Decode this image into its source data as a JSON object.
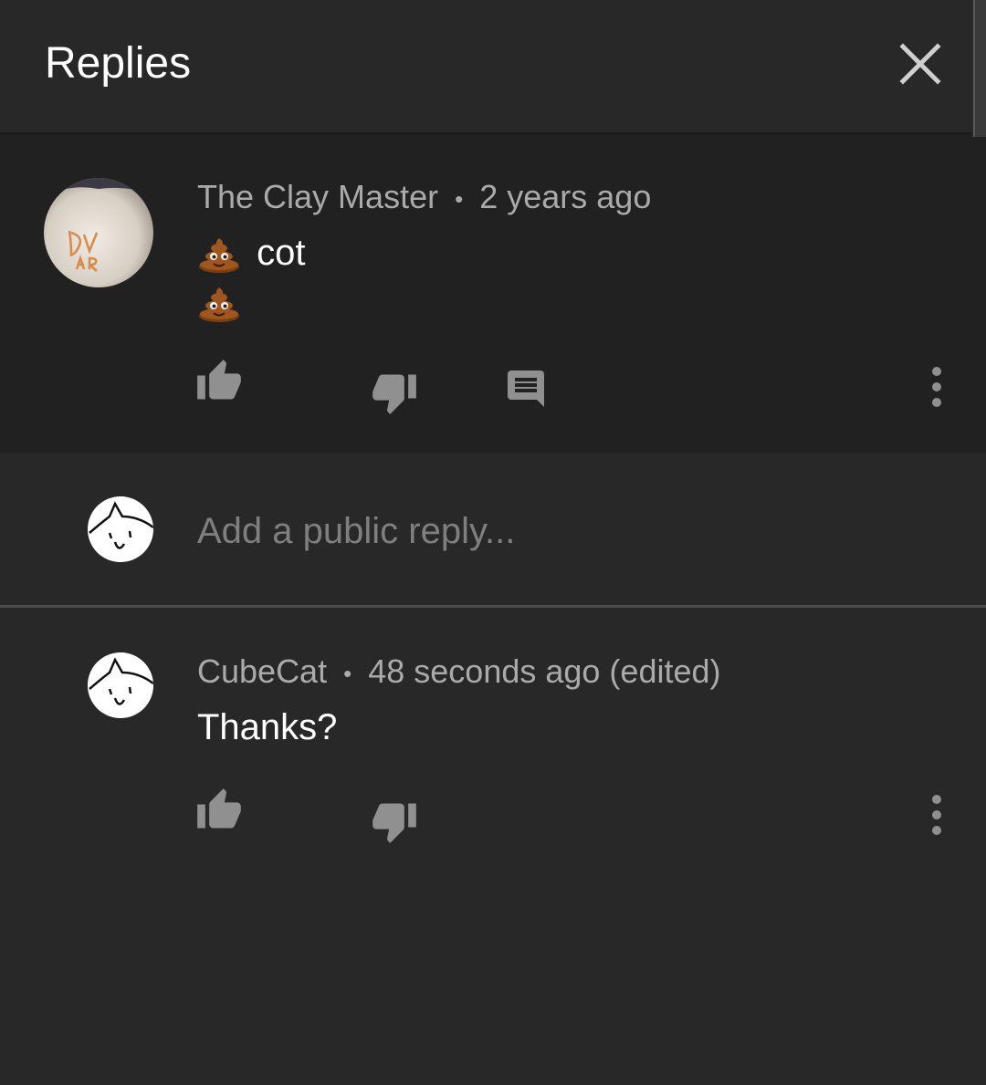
{
  "header": {
    "title": "Replies",
    "close_icon": "close-icon"
  },
  "parent_comment": {
    "author": "The Clay Master",
    "separator": "•",
    "time": "2 years ago",
    "line1_text": "cot",
    "emoji": "pile-of-poo",
    "actions": [
      "like-icon",
      "dislike-icon",
      "reply-icon",
      "more-icon"
    ]
  },
  "reply_box": {
    "placeholder": "Add a public reply..."
  },
  "reply": {
    "author": "CubeCat",
    "separator": "•",
    "time": "48 seconds ago (edited)",
    "text": "Thanks?",
    "actions": [
      "like-icon",
      "dislike-icon",
      "more-icon"
    ]
  },
  "colors": {
    "background": "#282828",
    "parent_background": "#212121",
    "meta_text": "#aaaaaa",
    "icon": "#909090",
    "divider": "#4a4a4a"
  }
}
